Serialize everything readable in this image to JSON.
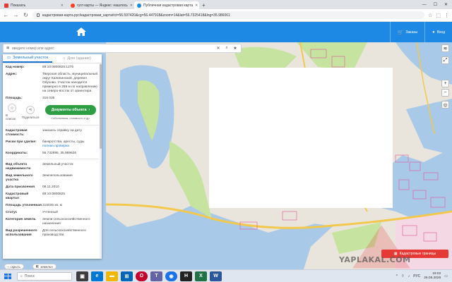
{
  "browser": {
    "tabs": [
      {
        "label": "Показать",
        "favicon_color": "#e53935",
        "active": false
      },
      {
        "label": "гугл карты — Яндекс: нашлось",
        "favicon_color": "#fc3f1d",
        "active": false
      },
      {
        "label": "Публичная кадастровая карта",
        "favicon_color": "#1e88e5",
        "active": true
      }
    ],
    "new_tab": "+",
    "url": "кадастровая-карта.рус/кадастровая_карта#ct=56.597420&cg=56.447918&zoom=14&lat=56.7325418&lng=35.986061"
  },
  "site": {
    "header_bg": "#1e88e5",
    "orders_label": "Заказы",
    "login_label": "Вход"
  },
  "search": {
    "placeholder": "введите номер или адрес"
  },
  "panel": {
    "tab_land": "Земельный участок",
    "tab_building": "Дом (здание)",
    "fields_top": [
      {
        "key": "Кад номер:",
        "value": "69:10:0800825:1275",
        "link": true
      },
      {
        "key": "Адрес:",
        "value": "Тверская область, муниципальный округ Калининский, деревня Обухово. Участок находится примерно в 289 м по направлению на северо-восток от ориентира",
        "link": false
      },
      {
        "key": "Площадь:",
        "value": "316 035",
        "link": false
      }
    ],
    "action_to_list": "В список",
    "action_share": "Поделиться",
    "doc_button": "Документы объекта",
    "doc_sub": "Собственник, стоимость и др.",
    "cadastral_cost_key": "Кадастровая стоимость:",
    "cadastral_cost_link": "заказать справку на дату",
    "risks_key": "Риски при сделке:",
    "risks_value": "банкротства, аресты, суды",
    "risks_link": "полная проверка",
    "coords_key": "Координаты:",
    "coords_value": "56.732895, 35.989626",
    "fields_bottom": [
      {
        "key": "Вид объекта недвижимости",
        "value": "Земельный участок"
      },
      {
        "key": "Вид земельного участка",
        "value": "Землепользование"
      },
      {
        "key": "Дата присвоения",
        "value": "08.11.2010"
      },
      {
        "key": "Кадастровый квартал",
        "value": "69:10:0800825"
      },
      {
        "key": "Площадь уточненная",
        "value": "316035 кв. м"
      },
      {
        "key": "Статус",
        "value": "Учтенный"
      },
      {
        "key": "Категория земель",
        "value": "Земли сельскохозяйственного назначения"
      },
      {
        "key": "Вид разрешенного использования",
        "value": "Для сельскохозяйственного производства"
      }
    ]
  },
  "map": {
    "water_color": "#a9c9e8",
    "land_color": "#e9e5dc",
    "green_color": "#c6e3a0",
    "badge_label": "Кадастровые границы",
    "pill_hide": "скрыть",
    "pill_layers": "земельн"
  },
  "taskbar": {
    "search_placeholder": "Поиск",
    "lang": "РУС",
    "time": "19:02",
    "date": "26.05.2026",
    "watermark": "YAPLAKAL.COM"
  }
}
